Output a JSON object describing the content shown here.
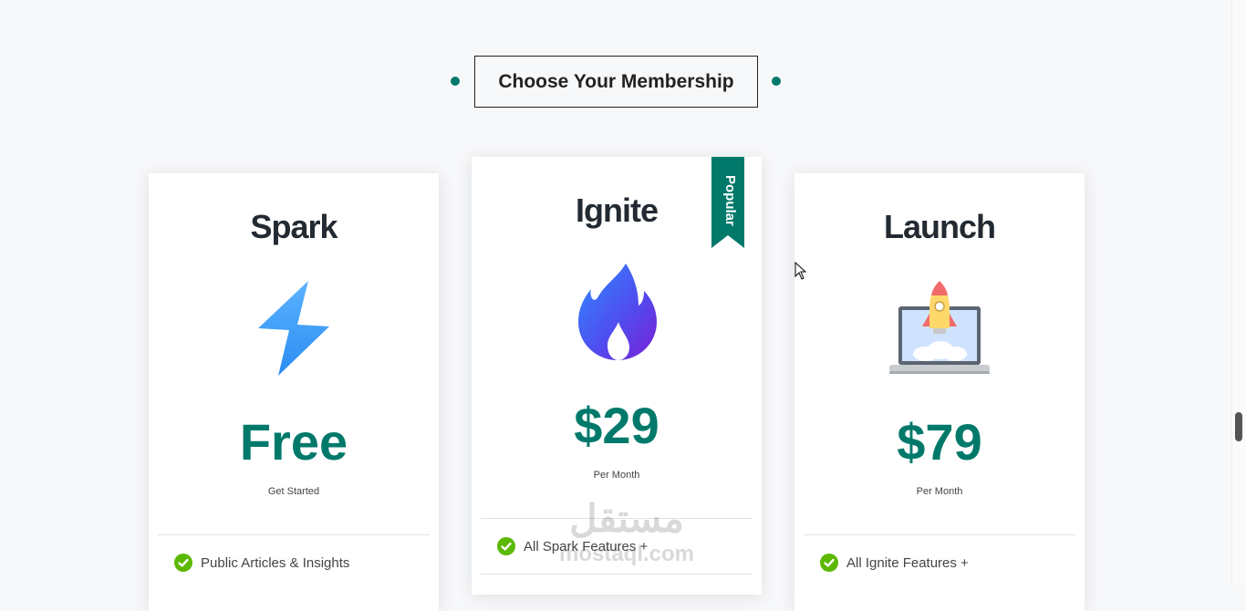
{
  "heading": "Choose Your Membership",
  "accent_color": "#00796b",
  "plans": [
    {
      "name": "Spark",
      "icon": "lightning-bolt-icon",
      "price": "Free",
      "subtext": "Get Started",
      "features": [
        "Public Articles & Insights"
      ]
    },
    {
      "name": "Ignite",
      "icon": "flame-icon",
      "badge": "Popular",
      "price": "$29",
      "subtext": "Per Month",
      "features": [
        "All Spark Features +"
      ]
    },
    {
      "name": "Launch",
      "icon": "rocket-laptop-icon",
      "price": "$79",
      "subtext": "Per Month",
      "features": [
        "All Ignite Features +"
      ]
    }
  ],
  "watermark": {
    "arabic": "مستقل",
    "latin": "mostaql.com"
  }
}
